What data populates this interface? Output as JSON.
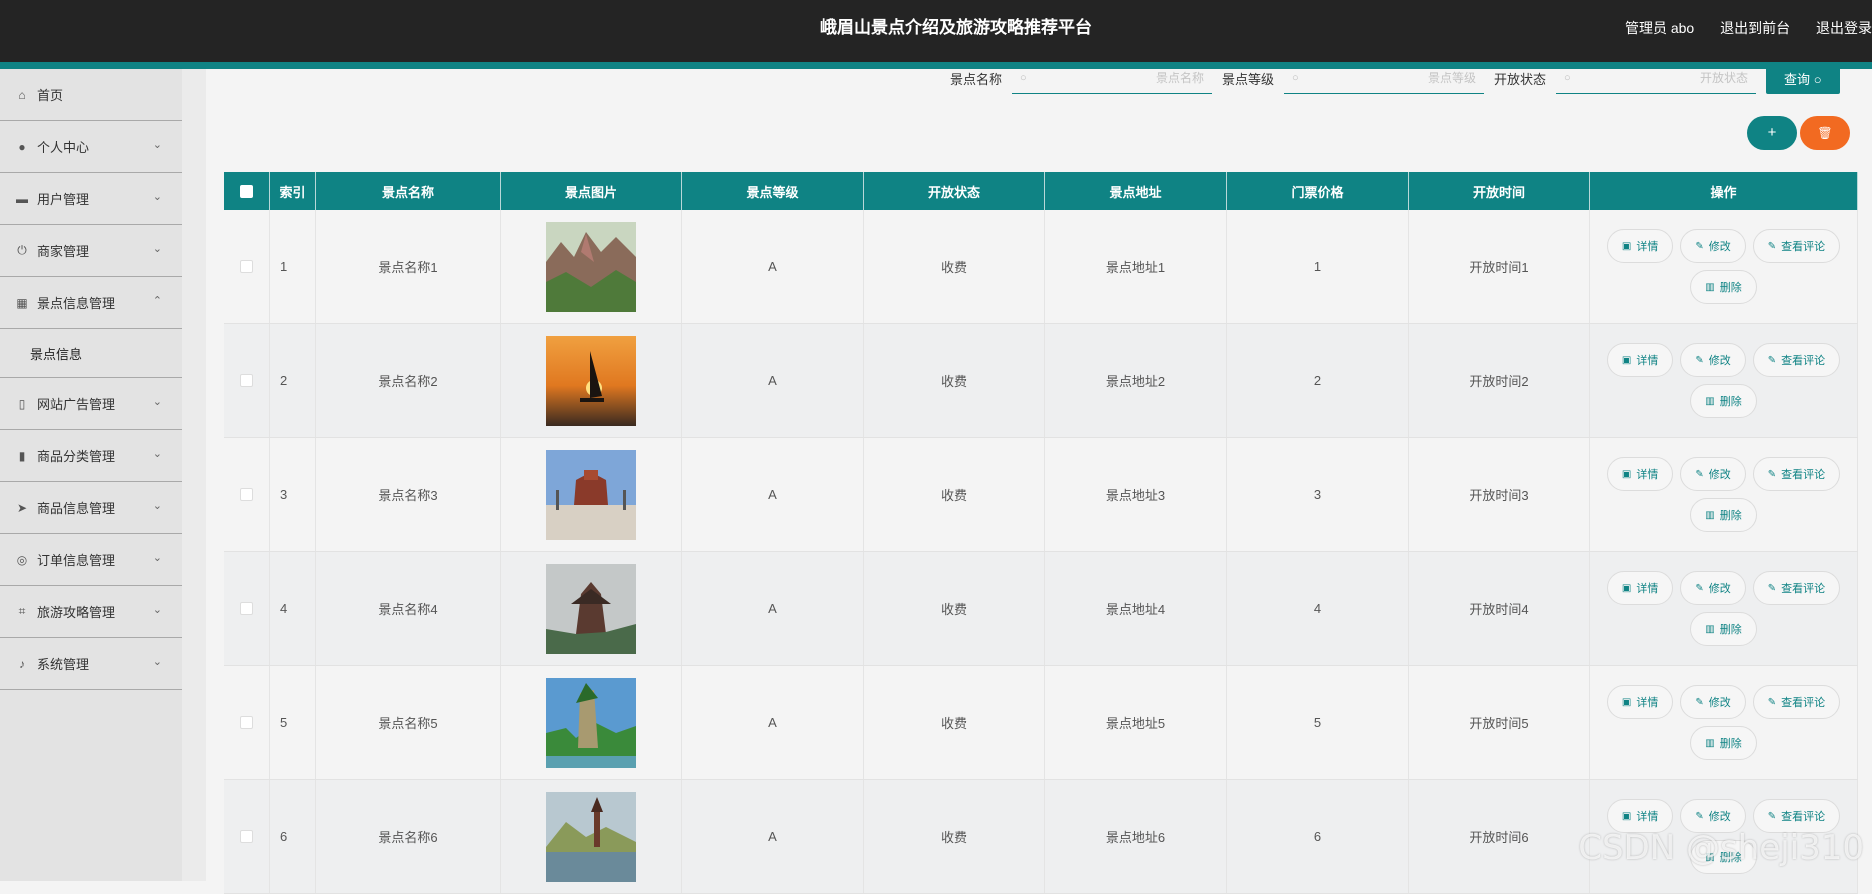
{
  "header": {
    "title": "峨眉山景点介绍及旅游攻略推荐平台",
    "user_label": "管理员 abo",
    "front_link": "退出到前台",
    "logout_link": "退出登录"
  },
  "sidebar": {
    "items": [
      {
        "label": "首页",
        "icon": "home-icon"
      },
      {
        "label": "个人中心",
        "icon": "user-icon"
      },
      {
        "label": "用户管理",
        "icon": "monitor-icon"
      },
      {
        "label": "商家管理",
        "icon": "power-icon"
      },
      {
        "label": "景点信息管理",
        "icon": "chart-icon"
      },
      {
        "label": "景点信息",
        "icon": ""
      },
      {
        "label": "网站广告管理",
        "icon": "phone-icon"
      },
      {
        "label": "商品分类管理",
        "icon": "bar-chart-icon"
      },
      {
        "label": "商品信息管理",
        "icon": "send-icon"
      },
      {
        "label": "订单信息管理",
        "icon": "compass-icon"
      },
      {
        "label": "旅游攻略管理",
        "icon": "crop-icon"
      },
      {
        "label": "系统管理",
        "icon": "mic-icon"
      }
    ]
  },
  "search": {
    "name_label": "景点名称",
    "name_placeholder": "景点名称",
    "level_label": "景点等级",
    "level_placeholder": "景点等级",
    "status_label": "开放状态",
    "status_placeholder": "开放状态",
    "query_button": "查询"
  },
  "actions": {
    "add": "+",
    "delete": "🗑"
  },
  "table": {
    "headers": [
      "索引",
      "景点名称",
      "景点图片",
      "景点等级",
      "开放状态",
      "景点地址",
      "门票价格",
      "开放时间",
      "操作"
    ],
    "op_labels": {
      "detail": "详情",
      "edit": "修改",
      "comments": "查看评论",
      "delete": "删除"
    },
    "rows": [
      {
        "index": "1",
        "name": "景点名称1",
        "level": "A",
        "status": "收费",
        "address": "景点地址1",
        "price": "1",
        "time": "开放时间1"
      },
      {
        "index": "2",
        "name": "景点名称2",
        "level": "A",
        "status": "收费",
        "address": "景点地址2",
        "price": "2",
        "time": "开放时间2"
      },
      {
        "index": "3",
        "name": "景点名称3",
        "level": "A",
        "status": "收费",
        "address": "景点地址3",
        "price": "3",
        "time": "开放时间3"
      },
      {
        "index": "4",
        "name": "景点名称4",
        "level": "A",
        "status": "收费",
        "address": "景点地址4",
        "price": "4",
        "time": "开放时间4"
      },
      {
        "index": "5",
        "name": "景点名称5",
        "level": "A",
        "status": "收费",
        "address": "景点地址5",
        "price": "5",
        "time": "开放时间5"
      },
      {
        "index": "6",
        "name": "景点名称6",
        "level": "A",
        "status": "收费",
        "address": "景点地址6",
        "price": "6",
        "time": "开放时间6"
      }
    ]
  },
  "watermark": "CSDN @sheji310",
  "colors": {
    "accent": "#0f8384",
    "danger": "#f26a21",
    "topbar": "#242424"
  }
}
